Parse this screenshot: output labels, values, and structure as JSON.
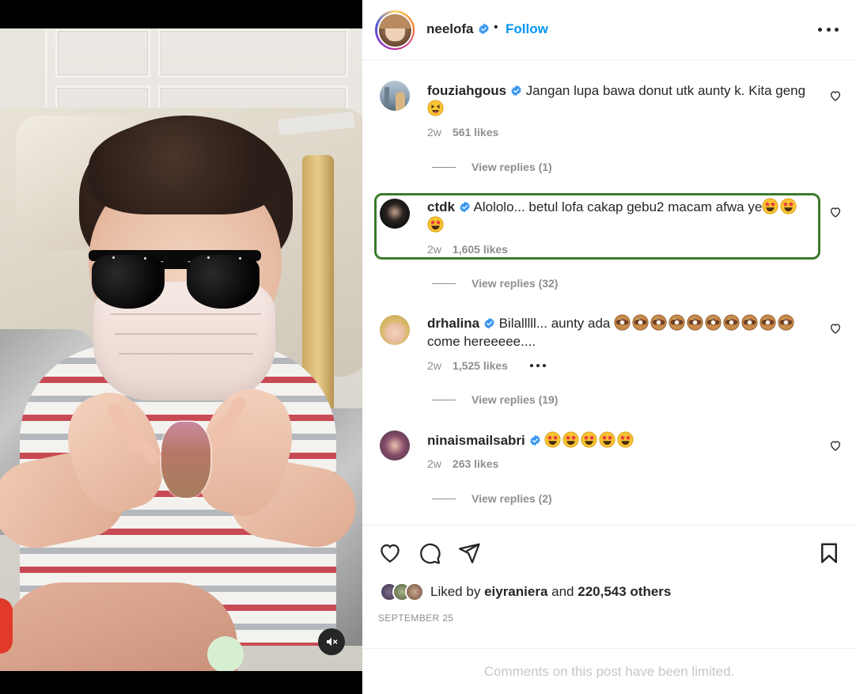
{
  "post": {
    "username": "neelofa",
    "separator": "•",
    "follow_label": "Follow",
    "date": "SEPTEMBER 25",
    "comments_limited": "Comments on this post have been limited."
  },
  "comments": [
    {
      "username": "fouziahgous",
      "text": "Jangan lupa bawa donut utk aunty k. Kita geng",
      "emojis": [
        "squint-tongue-emoji"
      ],
      "time": "2w",
      "likes": "561 likes",
      "replies": "View replies (1)"
    },
    {
      "username": "ctdk",
      "text": "Alololo... betul lofa cakap gebu2 macam afwa ye",
      "emojis": [
        "star-eyes-emoji",
        "star-eyes-emoji",
        "star-eyes-emoji"
      ],
      "time": "2w",
      "likes": "1,605 likes",
      "replies": "View replies (32)"
    },
    {
      "username": "drhalina",
      "text": "Bilalllll... aunty ada",
      "text_after": "come hereeeee....",
      "emojis": [
        "doughnut-emoji",
        "doughnut-emoji",
        "doughnut-emoji",
        "doughnut-emoji",
        "doughnut-emoji",
        "doughnut-emoji",
        "doughnut-emoji",
        "doughnut-emoji",
        "doughnut-emoji",
        "doughnut-emoji"
      ],
      "time": "2w",
      "likes": "1,525 likes",
      "replies": "View replies (19)"
    },
    {
      "username": "ninaismailsabri",
      "text": "",
      "emojis": [
        "star-eyes-emoji",
        "star-eyes-emoji",
        "star-eyes-emoji",
        "star-eyes-emoji",
        "star-eyes-emoji"
      ],
      "time": "2w",
      "likes": "263 likes",
      "replies": "View replies (2)"
    }
  ],
  "likes": {
    "prefix": "Liked by",
    "user": "eiyraniera",
    "middle": "and",
    "others": "220,543 others"
  },
  "icons": {
    "verified": "verified-badge-icon",
    "heart": "heart-icon",
    "comment": "comment-icon",
    "share": "share-icon",
    "save": "bookmark-icon",
    "more": "more-options-icon",
    "mute": "sound-off-icon"
  },
  "colors": {
    "link_blue": "#0095f6",
    "verified_blue": "#3897f0",
    "muted_text": "#8e8e8e",
    "highlight_border": "#3c7a2c"
  }
}
